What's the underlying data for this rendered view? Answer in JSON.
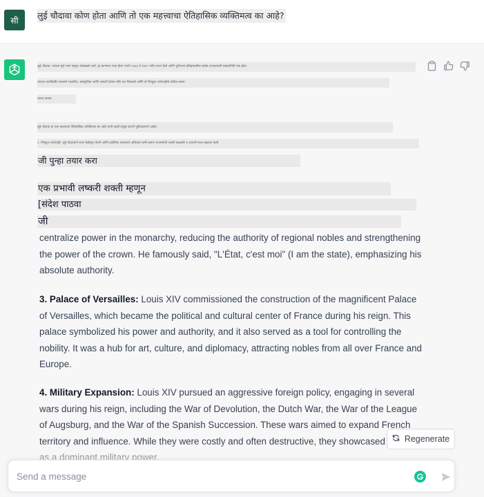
{
  "user": {
    "avatar_label": "सी",
    "message": "लुई चौदावा कोण होता आणि तो एक महत्त्वाचा ऐतिहासिक व्यक्तिमत्व का आहे?"
  },
  "assistant": {
    "icon": "openai-logo-icon",
    "garbled_lines": [
      "लुई चौदावा, ज्याला सूर्य राजा म्हणून ओळखले जाते, हा फ्रान्सचा राजा होता ज्याने १६४३ ते १७१५ पर्यंत राज्य केले आणि युरोपच्या इतिहासातील सर्वात प्रभावशाली सम्राटांपैकी एक होता",
      "त्याच्या कारकिर्दीत फ्रान्सने राजकीय, सांस्कृतिक आणि लष्करी क्षेत्रात मोठे यश मिळवले आणि तो निरंकुश राजेशाहीचे प्रतीक बनला",
      "त्याचा वारसा",
      "लुई चौदावा हा एक महत्त्वाचा ऐतिहासिक व्यक्तिमत्व का आहे याची काही प्रमुख कारणे पुढीलप्रमाणे आहेत",
      "१. निरंकुश राजेशाही: लुई चौदाव्याने सत्ता केंद्रीकृत केली आणि प्रादेशिक सरदारांचे अधिकार कमी करून राजसत्तेची शक्ती वाढवली व आपली सत्ता बळकट केली"
    ],
    "mixed_lines": [
      "जी पुन्हा तयार करा",
      "एक प्रभावी लष्करी शक्ती म्हणून",
      "[संदेश पाठवा",
      "जी"
    ],
    "para_a": "centralize power in the monarchy, reducing the authority of regional nobles and strengthening the power of the crown. He famously said, \"L'État, c'est moi\" (I am the state), emphasizing his absolute authority.",
    "para_b_heading": "3. Palace of Versailles:",
    "para_b_text": " Louis XIV commissioned the construction of the magnificent Palace of Versailles, which became the political and cultural center of France during his reign. This palace symbolized his power and authority, and it also served as a tool for controlling the nobility. It was a hub for art, culture, and diplomacy, attracting nobles from all over France and Europe.",
    "para_c_heading": "4. Military Expansion:",
    "para_c_text": " Louis XIV pursued an aggressive foreign policy, engaging in several wars during his reign, including the War of Devolution, the Dutch War, the War of the League of Augsburg, and the War of the Spanish Succession. These wars aimed to expand French territory and influence. While they were costly and often destructive, they showcased France as a dominant military power."
  },
  "actions": {
    "copy_icon": "clipboard-icon",
    "like_icon": "thumbs-up-icon",
    "dislike_icon": "thumbs-down-icon"
  },
  "regenerate": {
    "label": "Regenerate",
    "icon": "refresh-icon"
  },
  "composer": {
    "placeholder": "Send a message",
    "value": "",
    "extension_icon": "grammarly-icon",
    "send_icon": "send-icon"
  },
  "colors": {
    "user_avatar": "#1f5f48",
    "assistant_avatar": "#19c37d",
    "assistant_bg": "#f7f7f8",
    "grammarly": "#15c39a"
  }
}
